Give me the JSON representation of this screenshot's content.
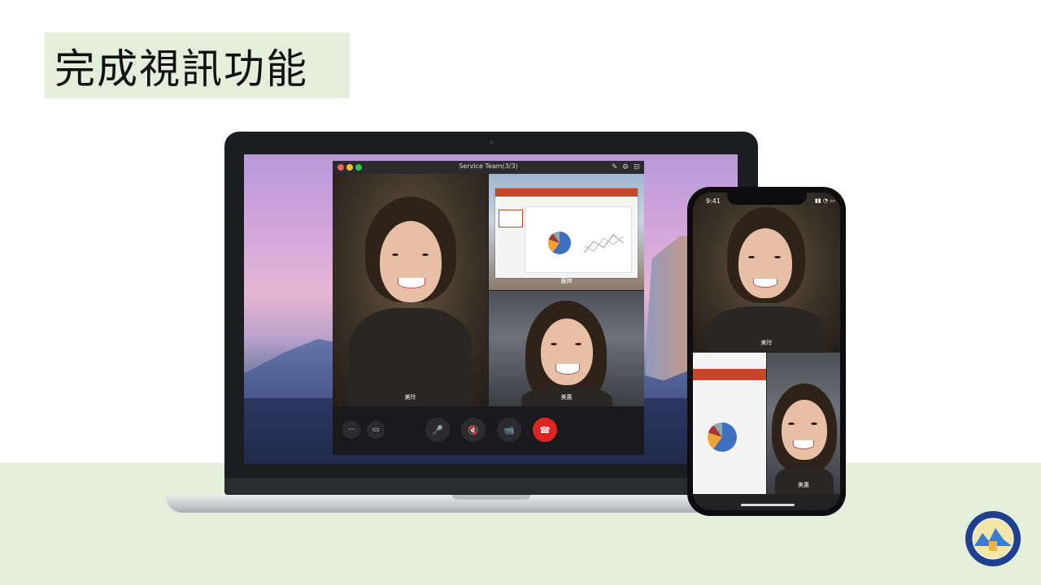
{
  "slide": {
    "title": "完成視訊功能"
  },
  "laptop_app": {
    "window_title": "Service Team(3/3)",
    "participants": [
      {
        "name": "美玲"
      },
      {
        "name": "雅婷"
      },
      {
        "name": "美惠"
      }
    ],
    "controls": [
      {
        "name": "more",
        "glyph": "⋯"
      },
      {
        "name": "share-screen",
        "glyph": "▭"
      },
      {
        "name": "microphone",
        "glyph": "🎤"
      },
      {
        "name": "speaker-mute",
        "glyph": "🔇"
      },
      {
        "name": "camera-off",
        "glyph": "📹"
      },
      {
        "name": "hang-up",
        "glyph": "☎"
      }
    ]
  },
  "phone_app": {
    "status_time": "9:41",
    "participants": [
      {
        "name": "美玲"
      },
      {
        "name": "美惠"
      }
    ]
  },
  "colors": {
    "title_bg": "#e3eedb",
    "band_bg": "#e3eedb",
    "hangup": "#e02424"
  }
}
